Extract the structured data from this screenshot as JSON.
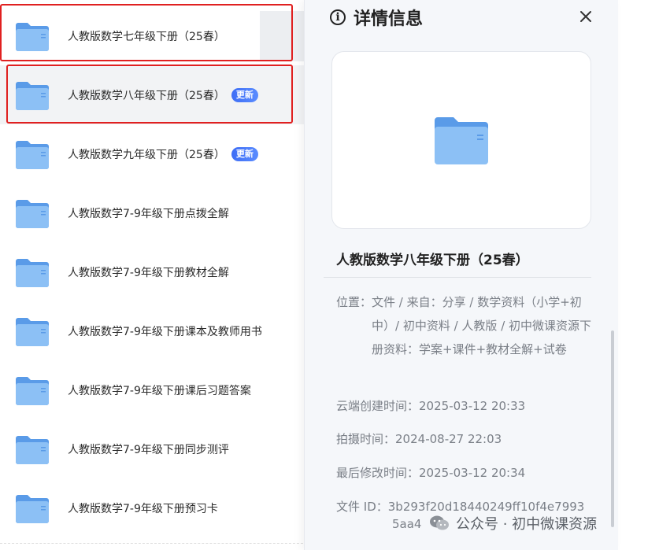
{
  "file_list": [
    {
      "name": "人教版数学七年级下册（25春）",
      "badge": ""
    },
    {
      "name": "人教版数学八年级下册（25春）",
      "badge": "更新"
    },
    {
      "name": "人教版数学九年级下册（25春）",
      "badge": "更新"
    },
    {
      "name": "人教版数学7-9年级下册点拨全解",
      "badge": ""
    },
    {
      "name": "人教版数学7-9年级下册教材全解",
      "badge": ""
    },
    {
      "name": "人教版数学7-9年级下册课本及教师用书",
      "badge": ""
    },
    {
      "name": "人教版数学7-9年级下册课后习题答案",
      "badge": ""
    },
    {
      "name": "人教版数学7-9年级下册同步测评",
      "badge": ""
    },
    {
      "name": "人教版数学7-9年级下册预习卡",
      "badge": ""
    }
  ],
  "details": {
    "title": "详情信息",
    "file_name": "人教版数学八年级下册（25春）",
    "location_label": "位置：",
    "location_value": "文件 / 来自：分享 / 数学资料（小学+初中）/ 初中资料 / 人教版 / 初中微课资源下册资料：学案+课件+教材全解+试卷",
    "created_label": "云端创建时间：",
    "created_value": "2025-03-12 20:33",
    "shot_label": "拍摄时间：",
    "shot_value": "2024-08-27 22:03",
    "modified_label": "最后修改时间：",
    "modified_value": "2025-03-12 20:34",
    "fileid_label": "文件 ID：",
    "fileid_value_line1": "3b293f20d18440249ff10f4e7993",
    "fileid_value_line2": "5aa4"
  },
  "watermark": "公众号 · 初中微课资源",
  "colors": {
    "folder": "#6aa9ee",
    "badge": "#3e6df5",
    "highlight_box": "#e02020"
  }
}
